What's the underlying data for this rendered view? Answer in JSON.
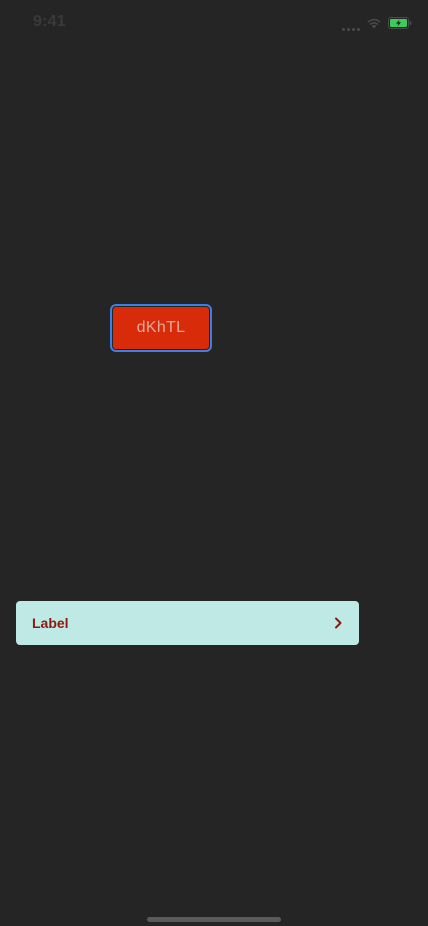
{
  "status_bar": {
    "time": "9:41",
    "icons": [
      "cellular-signal-icon",
      "wifi-icon",
      "battery-charging-icon"
    ]
  },
  "button": {
    "label": "dKhTL",
    "colors": {
      "fill": "#d72b0a",
      "focus_ring": "#3d7fe6",
      "text": "#e2a998"
    }
  },
  "list_cell": {
    "label": "Label",
    "icon": "chevron-right-icon",
    "colors": {
      "background": "#bfe9e4",
      "text": "#8b1a10"
    }
  },
  "theme": {
    "background": "#252525"
  }
}
